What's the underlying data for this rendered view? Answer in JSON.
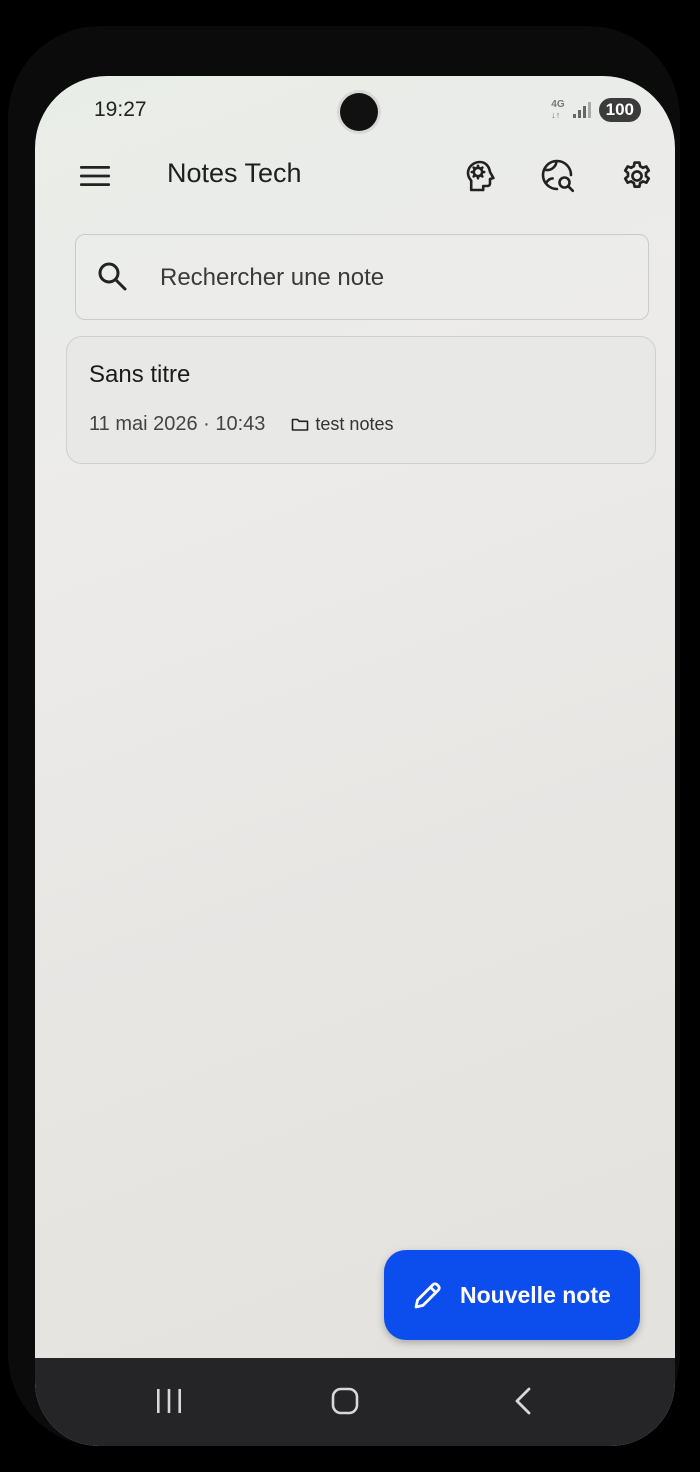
{
  "status": {
    "time": "19:27",
    "network": "4G",
    "battery": "100"
  },
  "appbar": {
    "title": "Notes Tech",
    "icons": [
      "menu-icon",
      "brain-icon",
      "world-search-icon",
      "settings-icon"
    ]
  },
  "search": {
    "placeholder": "Rechercher une note"
  },
  "notes": [
    {
      "title": "Sans titre",
      "date": "11 mai 2026 · 10:43",
      "folder": "test notes"
    }
  ],
  "fab": {
    "label": "Nouvelle note"
  },
  "colors": {
    "accent": "#0c4ded",
    "navbar": "#252527"
  }
}
